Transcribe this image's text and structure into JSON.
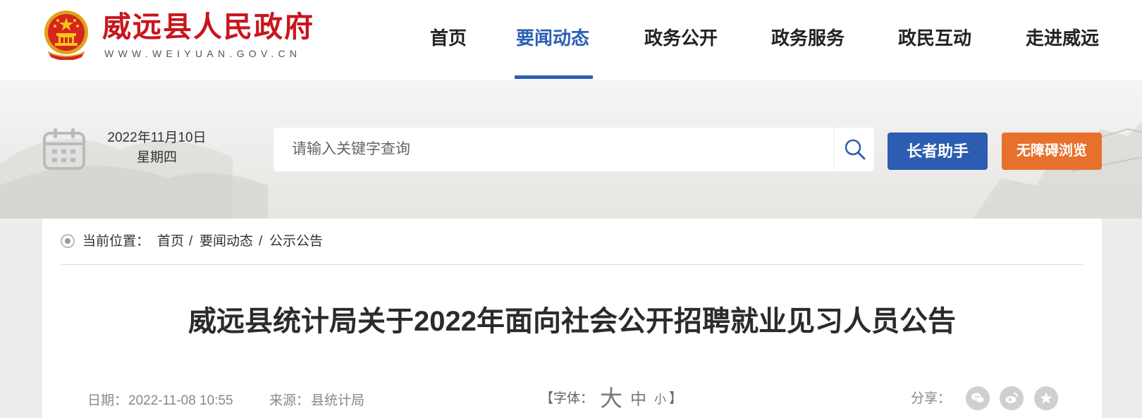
{
  "header": {
    "site_name": "威远县人民政府",
    "site_url": "WWW.WEIYUAN.GOV.CN",
    "brand_color": "#c8161d",
    "nav": [
      {
        "label": "首页",
        "active": false
      },
      {
        "label": "要闻动态",
        "active": true
      },
      {
        "label": "政务公开",
        "active": false
      },
      {
        "label": "政务服务",
        "active": false
      },
      {
        "label": "政民互动",
        "active": false
      },
      {
        "label": "走进威远",
        "active": false
      }
    ],
    "active_color": "#2a5fb5"
  },
  "toolbar": {
    "date": "2022年11月10日",
    "weekday": "星期四",
    "search_placeholder": "请输入关键字查询",
    "elder_button": "长者助手",
    "elder_color": "#2c5db0",
    "access_button": "无障碍浏览",
    "access_color": "#e8702d"
  },
  "breadcrumb": {
    "label": "当前位置：",
    "items": [
      "首页",
      "要闻动态",
      "公示公告"
    ],
    "separator": "/"
  },
  "article": {
    "title": "威远县统计局关于2022年面向社会公开招聘就业见习人员公告",
    "date_label": "日期：",
    "date": "2022-11-08 10:55",
    "source_label": "来源：",
    "source": "县统计局",
    "font_open": "【字体：",
    "font_large": "大",
    "font_medium": "中",
    "font_small": "小",
    "font_close": "】",
    "share_label": "分享：",
    "share_icons": [
      "wechat-icon",
      "weibo-icon",
      "favorite-icon"
    ]
  }
}
